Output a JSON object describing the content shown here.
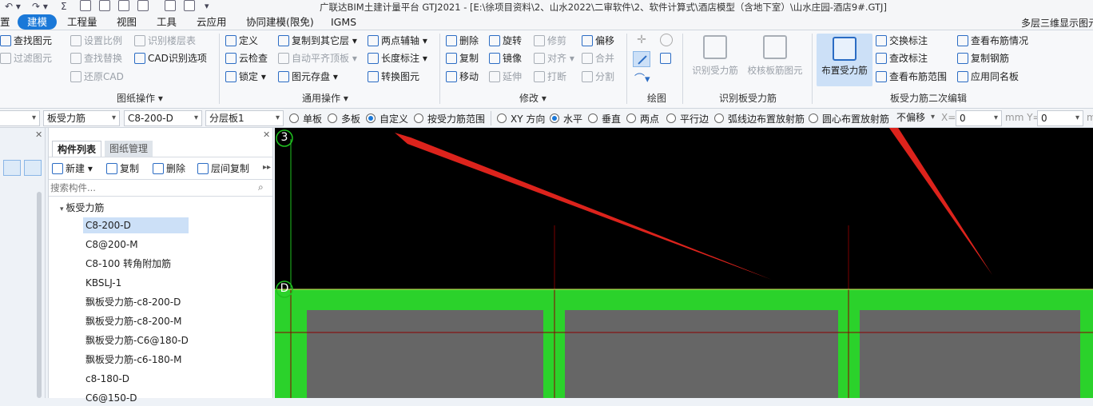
{
  "title": "广联达BIM土建计量平台 GTJ2021 - [E:\\徐项目资料\\2、山水2022\\二审软件\\2、软件计算式\\酒店模型（含地下室）\\山水庄园-酒店9#.GTJ]",
  "right_status": "多层三维显示图元",
  "menus": [
    "置",
    "建模",
    "工程量",
    "视图",
    "工具",
    "云应用",
    "协同建模(限免)",
    "IGMS"
  ],
  "ribbon": {
    "drawing": {
      "items": [
        "查找图元",
        "过滤图元",
        "设置比例",
        "识别楼层表",
        "查找替换",
        "CAD识别选项",
        "还原CAD"
      ],
      "group": "图纸操作 ▾"
    },
    "general": {
      "items": [
        "定义",
        "复制到其它层 ▾",
        "两点辅轴 ▾",
        "云检查",
        "自动平齐顶板 ▾",
        "长度标注 ▾",
        "锁定 ▾",
        "图元存盘 ▾",
        "转换图元"
      ],
      "group": "通用操作 ▾"
    },
    "modify": {
      "items": [
        "删除",
        "旋转",
        "修剪",
        "偏移",
        "复制",
        "镜像",
        "对齐 ▾",
        "合并",
        "移动",
        "延伸",
        "打断",
        "分割"
      ],
      "group": "修改 ▾"
    },
    "draw": {
      "group": "绘图"
    },
    "recognize": {
      "items": [
        "识别受力筋",
        "校核板筋图元"
      ],
      "group": "识别板受力筋"
    },
    "edit2": {
      "big": "布置受力筋",
      "items": [
        "交换标注",
        "查看布筋情况",
        "查改标注",
        "复制钢筋",
        "查看布筋范围",
        "应用同名板"
      ],
      "group": "板受力筋二次编辑"
    }
  },
  "propbar": {
    "type": "板受力筋",
    "name": "C8-200-D",
    "layer": "分层板1",
    "radios": [
      "单板",
      "多板",
      "自定义",
      "按受力筋范围",
      "XY 方向",
      "水平",
      "垂直",
      "两点",
      "平行边",
      "弧线边布置放射筋",
      "圆心布置放射筋"
    ],
    "offset": "不偏移",
    "x_label": "X=",
    "x_value": "0",
    "y_label": "mm Y=",
    "y_value": "0",
    "unit": "m"
  },
  "panel": {
    "tabs": [
      "构件列表",
      "图纸管理"
    ],
    "tools": [
      "新建 ▾",
      "复制",
      "删除",
      "层间复制"
    ],
    "search_placeholder": "搜索构件...",
    "root": "板受力筋",
    "items": [
      "C8-200-D",
      "C8@200-M",
      "C8-100 转角附加筋",
      "KBSLJ-1",
      "飘板受力筋-c8-200-D",
      "飘板受力筋-c8-200-M",
      "飘板受力筋-C6@180-D",
      "飘板受力筋-c6-180-M",
      "c8-180-D",
      "C6@150-D"
    ]
  },
  "canvas": {
    "axis_top": "3",
    "axis_mid": "D"
  }
}
